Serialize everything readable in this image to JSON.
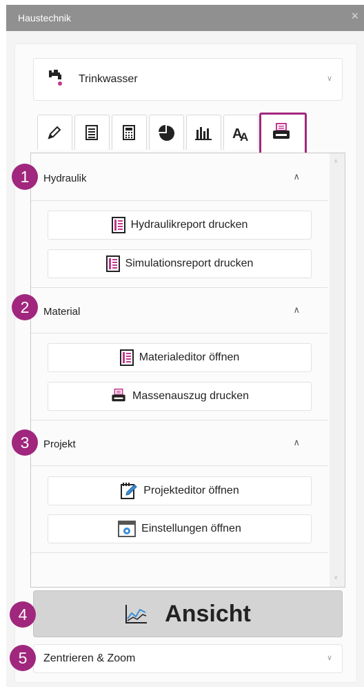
{
  "window": {
    "title": "Haustechnik",
    "close_label": "×"
  },
  "discipline": {
    "selected": "Trinkwasser"
  },
  "tabs": [
    {
      "icon": "pencil-icon"
    },
    {
      "icon": "list-icon"
    },
    {
      "icon": "calculator-icon"
    },
    {
      "icon": "pie-chart-icon"
    },
    {
      "icon": "bar-chart-icon"
    },
    {
      "icon": "text-style-icon"
    },
    {
      "icon": "printer-icon",
      "active": true
    }
  ],
  "sections": [
    {
      "badge": "1",
      "title": "Hydraulik",
      "buttons": [
        {
          "label": "Hydraulikreport drucken",
          "icon": "report-icon"
        },
        {
          "label": "Simulationsreport drucken",
          "icon": "report-icon"
        }
      ]
    },
    {
      "badge": "2",
      "title": "Material",
      "buttons": [
        {
          "label": "Materialeditor öffnen",
          "icon": "report-icon"
        },
        {
          "label": "Massenauszug drucken",
          "icon": "printer-icon"
        }
      ]
    },
    {
      "badge": "3",
      "title": "Projekt",
      "buttons": [
        {
          "label": "Projekteditor öffnen",
          "icon": "edit-document-icon"
        },
        {
          "label": "Einstellungen öffnen",
          "icon": "settings-window-icon"
        }
      ]
    }
  ],
  "view_button": {
    "badge": "4",
    "label": "Ansicht"
  },
  "zoom": {
    "badge": "5",
    "label": "Zentrieren & Zoom"
  },
  "colors": {
    "accent": "#a0277d",
    "titlebar": "#909090"
  }
}
